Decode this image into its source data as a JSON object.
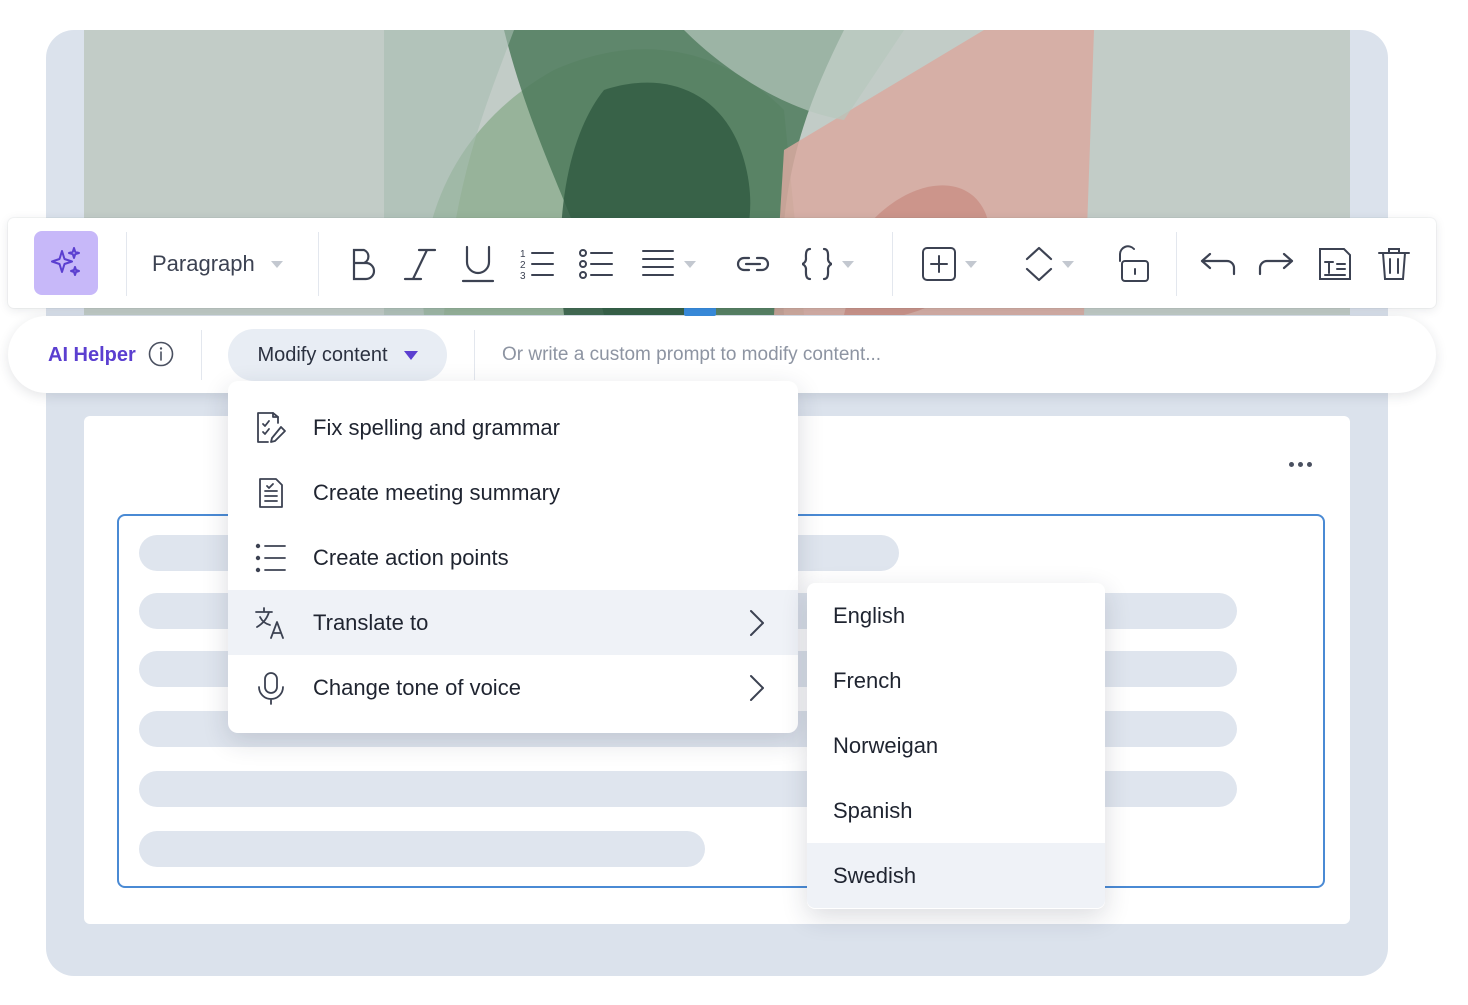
{
  "toolbar": {
    "paragraph_style": "Paragraph",
    "buttons": [
      "ai-sparkle-icon",
      "bold-icon",
      "italic-icon",
      "underline-icon",
      "ordered-list-icon",
      "bullet-list-icon",
      "align-icon",
      "link-icon",
      "code-braces-icon",
      "add-block-icon",
      "move-icon",
      "unlock-icon",
      "undo-icon",
      "redo-icon",
      "text-block-icon",
      "trash-icon"
    ]
  },
  "ai_bar": {
    "label": "AI Helper",
    "modify_button": "Modify content",
    "prompt_placeholder": "Or write a custom prompt to modify content..."
  },
  "menu": {
    "items": [
      {
        "label": "Fix spelling and grammar",
        "icon": "spellcheck-icon"
      },
      {
        "label": "Create meeting summary",
        "icon": "document-icon"
      },
      {
        "label": "Create action points",
        "icon": "list-icon"
      },
      {
        "label": "Translate to",
        "icon": "translate-icon",
        "has_submenu": true,
        "active": true
      },
      {
        "label": "Change tone of voice",
        "icon": "microphone-icon",
        "has_submenu": true
      }
    ]
  },
  "translate_submenu": {
    "languages": [
      "English",
      "French",
      "Norweigan",
      "Spanish",
      "Swedish"
    ],
    "highlighted": "Swedish"
  },
  "colors": {
    "accent": "#5b3fd0",
    "ai_button_bg": "#c7b8f9",
    "editor_border": "#4a8ad4",
    "frame_bg": "#dbe2ec"
  }
}
